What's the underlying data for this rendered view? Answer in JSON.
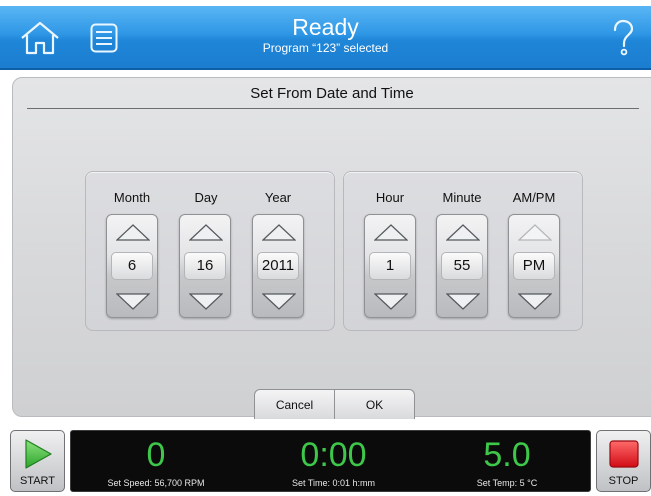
{
  "header": {
    "title": "Ready",
    "subtitle": "Program “123” selected",
    "home_icon": "home-icon",
    "menu_icon": "list-menu-icon",
    "help_icon": "question-mark-icon",
    "accent_color": "#2f97e6"
  },
  "dialog": {
    "title": "Set From Date and Time",
    "date": {
      "month": {
        "label": "Month",
        "value": "6"
      },
      "day": {
        "label": "Day",
        "value": "16"
      },
      "year": {
        "label": "Year",
        "value": "2011"
      }
    },
    "time": {
      "hour": {
        "label": "Hour",
        "value": "1"
      },
      "minute": {
        "label": "Minute",
        "value": "55"
      },
      "ampm": {
        "label": "AM/PM",
        "value": "PM"
      }
    },
    "cancel_label": "Cancel",
    "ok_label": "OK"
  },
  "controls": {
    "start_label": "START",
    "stop_label": "STOP",
    "start_color": "#3cbf3c",
    "stop_color": "#e0141e"
  },
  "status": {
    "speed_value": "0",
    "speed_set": "Set Speed: 56,700 RPM",
    "time_value": "0:00",
    "time_set": "Set Time: 0:01 h:mm",
    "temp_value": "5.0",
    "temp_set": "Set Temp: 5 °C",
    "value_color": "#3ec84a"
  }
}
